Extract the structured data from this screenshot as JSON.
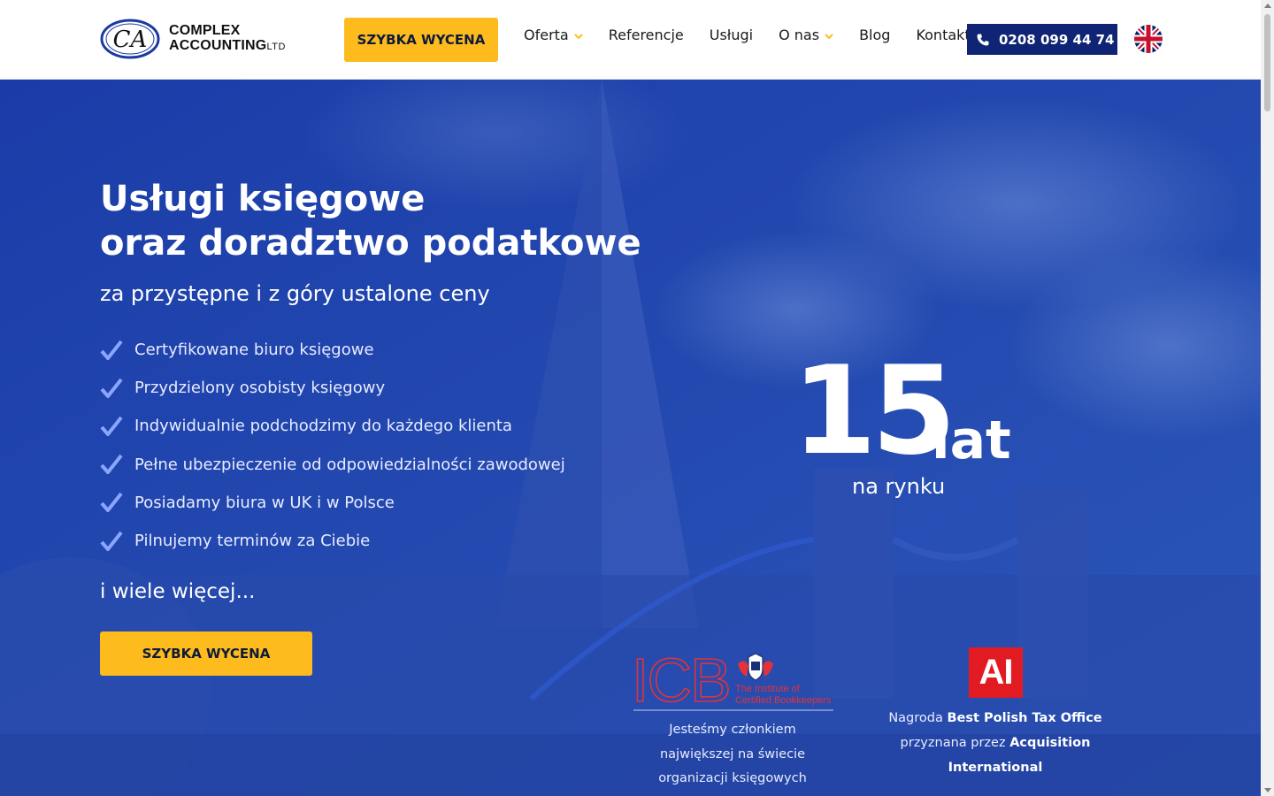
{
  "header": {
    "logo": {
      "line1": "COMPLEX",
      "line2": "ACCOUNTING",
      "suffix": "LTD",
      "mark_letters": "CA"
    },
    "quote_button": "SZYBKA WYCENA",
    "nav": [
      {
        "label": "Oferta",
        "dropdown": true
      },
      {
        "label": "Referencje",
        "dropdown": false
      },
      {
        "label": "Usługi",
        "dropdown": false
      },
      {
        "label": "O nas",
        "dropdown": true
      },
      {
        "label": "Blog",
        "dropdown": false
      },
      {
        "label": "Kontakt",
        "dropdown": false
      }
    ],
    "phone": "0208 099 44 74",
    "language_icon": "uk-flag-icon"
  },
  "hero": {
    "title_line1": "Usługi księgowe",
    "title_line2": "oraz doradztwo podatkowe",
    "subtitle": "za przystępne i z góry ustalone ceny",
    "features": [
      "Certyfikowane biuro księgowe",
      "Przydzielony osobisty księgowy",
      "Indywidualnie podchodzimy do każdego klienta",
      "Pełne ubezpieczenie od odpowiedzialności zawodowej",
      "Posiadamy biura w UK i w Polsce",
      "Pilnujemy terminów za Ciebie"
    ],
    "more": "i wiele więcej...",
    "quote_button": "SZYBKA WYCENA",
    "stat": {
      "number": "15",
      "unit": "lat",
      "caption": "na rynku"
    },
    "icb": {
      "logo_letters": "ICB",
      "logo_caption_line1": "The Institute of",
      "logo_caption_line2": "Certified Bookkeepers",
      "text_line1": "Jesteśmy członkiem",
      "text_line2": "największej na świecie",
      "text_line3": "organizacji księgowych"
    },
    "award": {
      "logo": "AI",
      "prefix1": "Nagroda ",
      "bold1": "Best Polish Tax Office",
      "prefix2": "przyznana przez ",
      "bold2": "Acquisition International"
    }
  },
  "colors": {
    "accent_yellow": "#fdbb1e",
    "navy": "#0f2474",
    "hero_blue": "#1f46b0",
    "check_color": "#8aa6ff",
    "ai_red": "#e21b23"
  }
}
